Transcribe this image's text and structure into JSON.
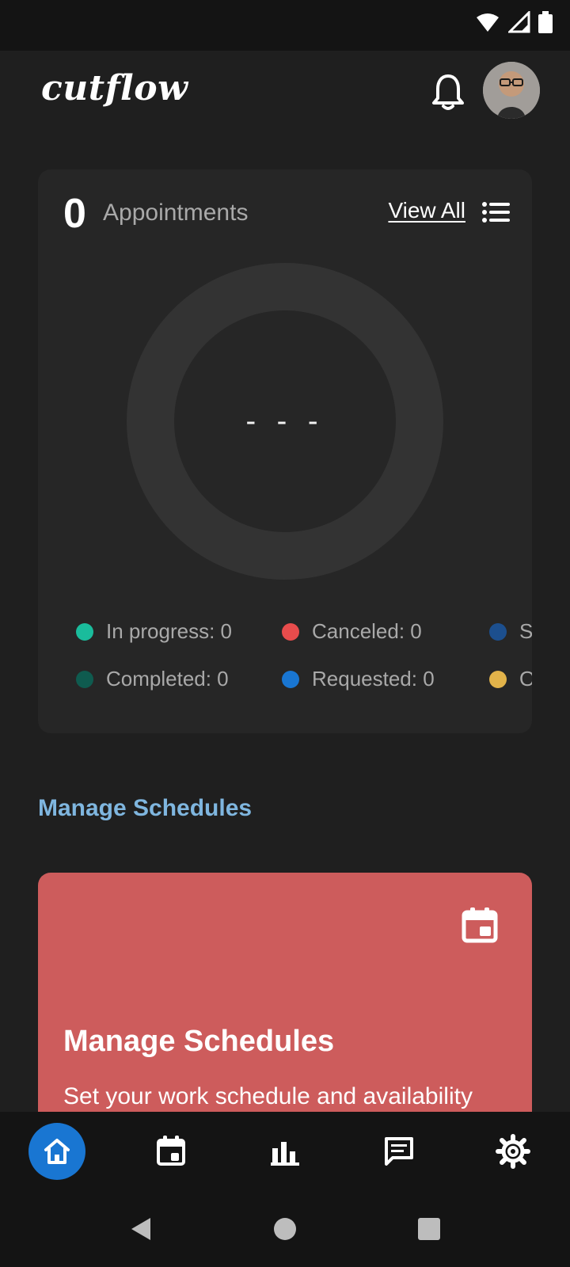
{
  "app": {
    "logo_text": "cutflow",
    "icons": {
      "notifications": "bell-icon",
      "profile": "avatar"
    }
  },
  "appointments": {
    "count": "0",
    "label": "Appointments",
    "view_all": "View All",
    "center_placeholder": "- - -",
    "legend": [
      {
        "label": "In progress: 0",
        "color": "#1abc9c"
      },
      {
        "label": "Canceled: 0",
        "color": "#e84c4c"
      },
      {
        "label": "S",
        "color": "#1c4f8e"
      },
      {
        "label": "Completed: 0",
        "color": "#0f5b4f"
      },
      {
        "label": "Requested: 0",
        "color": "#1976d2"
      },
      {
        "label": "O",
        "color": "#e2b34a"
      }
    ]
  },
  "manage": {
    "section_title": "Manage Schedules",
    "card_title": "Manage Schedules",
    "card_description": "Set your work schedule and availability",
    "card_color": "#cd5c5c"
  },
  "bottom_nav": [
    {
      "name": "home",
      "icon": "home-icon"
    },
    {
      "name": "calendar",
      "icon": "calendar-icon"
    },
    {
      "name": "stats",
      "icon": "bar-chart-icon"
    },
    {
      "name": "messages",
      "icon": "message-icon"
    },
    {
      "name": "settings",
      "icon": "gear-icon"
    }
  ]
}
